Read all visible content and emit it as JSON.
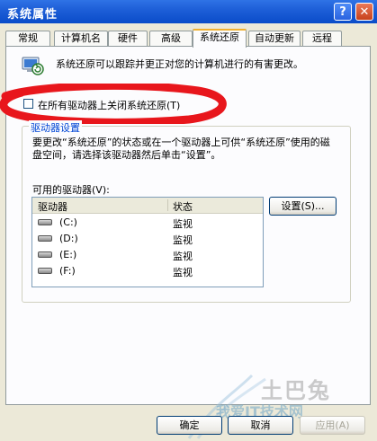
{
  "window": {
    "title": "系统属性",
    "help_glyph": "?",
    "close_glyph": "✕"
  },
  "tabs": [
    {
      "label": "常规"
    },
    {
      "label": "计算机名"
    },
    {
      "label": "硬件"
    },
    {
      "label": "高级"
    },
    {
      "label": "系统还原",
      "active": true
    },
    {
      "label": "自动更新"
    },
    {
      "label": "远程"
    }
  ],
  "intro_text": "系统还原可以跟踪并更正对您的计算机进行的有害更改。",
  "checkbox": {
    "label": "在所有驱动器上关闭系统还原(T)",
    "checked": false
  },
  "group": {
    "title": "驱动器设置",
    "description": "要更改“系统还原”的状态或在一个驱动器上可供“系统还原”使用的磁盘空间，请选择该驱动器然后单击“设置”。",
    "available_label": "可用的驱动器(V):",
    "columns": [
      "驱动器",
      "状态"
    ],
    "drives": [
      {
        "name": "(C:)",
        "status": "监视"
      },
      {
        "name": "(D:)",
        "status": "监视"
      },
      {
        "name": "(E:)",
        "status": "监视"
      },
      {
        "name": "(F:)",
        "status": "监视"
      }
    ],
    "settings_button": "设置(S)..."
  },
  "footer": {
    "ok": "确定",
    "cancel": "取消",
    "apply": "应用(A)"
  },
  "watermark": {
    "brand": "土巴兔",
    "site": "我爱IT技术网"
  },
  "colors": {
    "title_bar": "#0a4cc9",
    "dialog_bg": "#ece9d8",
    "annotation": "#e8161c",
    "group_title": "#0046d5"
  }
}
